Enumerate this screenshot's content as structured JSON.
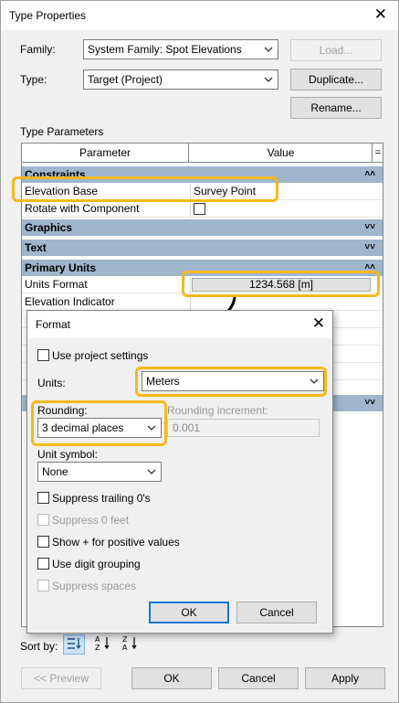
{
  "window": {
    "title": "Type Properties",
    "close_glyph": "✕"
  },
  "family": {
    "label": "Family:",
    "value": "System Family: Spot Elevations"
  },
  "type": {
    "label": "Type:",
    "value": "Target (Project)"
  },
  "buttons": {
    "load": "Load...",
    "duplicate": "Duplicate...",
    "rename": "Rename..."
  },
  "type_parameters": {
    "label": "Type Parameters",
    "col_parameter": "Parameter",
    "col_value": "Value",
    "col_extra": "=",
    "groups": {
      "constraints": "Constraints",
      "graphics": "Graphics",
      "text": "Text",
      "primary_units": "Primary Units"
    },
    "rows": {
      "elevation_base": {
        "name": "Elevation Base",
        "value": "Survey Point"
      },
      "rotate_with_component": {
        "name": "Rotate with Component"
      },
      "units_format": {
        "name": "Units Format",
        "value": "1234.568 [m]"
      },
      "elevation_indicator": {
        "name": "Elevation Indicator"
      }
    }
  },
  "sort": {
    "label": "Sort by:"
  },
  "footer": {
    "preview": "<< Preview",
    "ok": "OK",
    "cancel": "Cancel",
    "apply": "Apply"
  },
  "format_dialog": {
    "title": "Format",
    "close_glyph": "✕",
    "use_project_settings": "Use project settings",
    "units_label": "Units:",
    "units_value": "Meters",
    "rounding_label": "Rounding:",
    "rounding_value": "3 decimal places",
    "rounding_increment_label": "Rounding increment:",
    "rounding_increment_value": "0.001",
    "unit_symbol_label": "Unit symbol:",
    "unit_symbol_value": "None",
    "checkboxes": {
      "suppress_trailing": "Suppress trailing 0's",
      "suppress_feet": "Suppress 0 feet",
      "show_plus": "Show + for positive values",
      "digit_grouping": "Use digit grouping",
      "suppress_spaces": "Suppress spaces"
    },
    "ok": "OK",
    "cancel": "Cancel"
  },
  "colors": {
    "highlight": "#f6b81e",
    "group_header": "#9fb6cd",
    "accent": "#0078d7"
  },
  "icons": [
    "close-icon",
    "chevron-down-icon",
    "collapse-icon",
    "expand-icon",
    "sort-by-group-icon",
    "sort-az-icon",
    "sort-za-icon",
    "arrow-icon"
  ]
}
